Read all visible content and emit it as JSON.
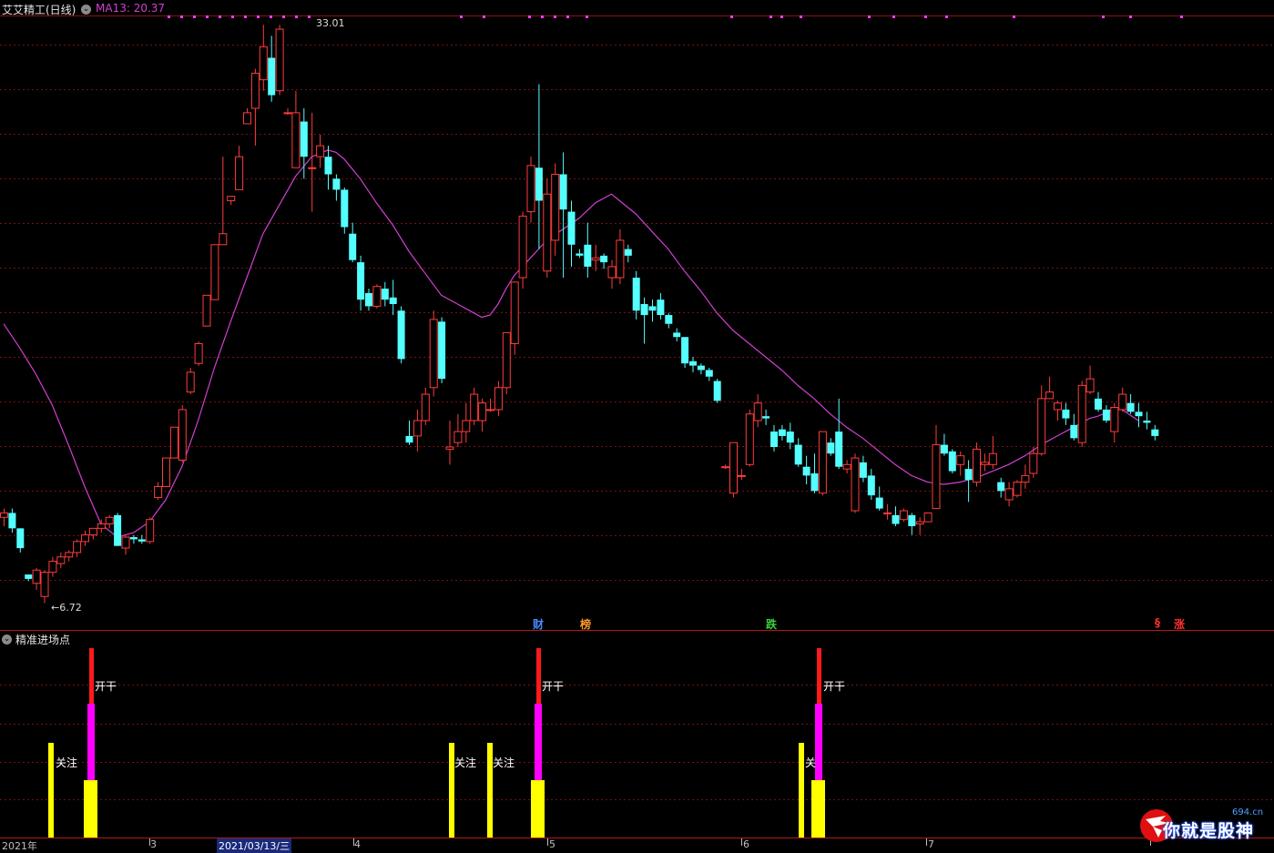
{
  "header": {
    "stock_name": "艾艾精工(日线)",
    "ma_label": "MA13: 20.37",
    "colors": {
      "title": "#e6e6e6",
      "ma": "#d040d0"
    }
  },
  "main_chart": {
    "high_label": "33.01",
    "low_label": "6.72",
    "event_labels": [
      {
        "text": "财",
        "color": "#4a8cff"
      },
      {
        "text": "榜",
        "color": "#ff9a2a"
      },
      {
        "text": "跌",
        "color": "#3bd13b"
      },
      {
        "text": "§",
        "color": "#ff3030"
      },
      {
        "text": "涨",
        "color": "#ff3030"
      }
    ],
    "colors": {
      "up": "#ff3c3c",
      "down": "#54ffff",
      "grid": "#7a1010",
      "ma": "#d040d0"
    }
  },
  "indicator": {
    "title": "精准进场点",
    "labels": {
      "watch": "关注",
      "open": "开干",
      "watch_partial": "关"
    },
    "colors": {
      "yellow": "#ffff00",
      "magenta": "#ff00ff",
      "red": "#ff1a1a"
    }
  },
  "axis": {
    "labels": [
      "2021年",
      "3",
      "2021/03/13/三",
      "4",
      "5",
      "6",
      "7"
    ]
  },
  "watermark": {
    "domain": "694.cn",
    "slogan": "你就是股神"
  },
  "chart_data": {
    "type": "candlestick",
    "title": "艾艾精工(日线)",
    "indicator": "MA13",
    "ma_last": 20.37,
    "price_high": 33.01,
    "price_low": 6.72,
    "y_range": [
      6.0,
      34.0
    ],
    "grid": true,
    "candles": [
      [
        10.6,
        11.0,
        10.2,
        10.8
      ],
      [
        10.8,
        11.0,
        9.9,
        10.1
      ],
      [
        10.1,
        10.1,
        9.0,
        9.2
      ],
      [
        8.0,
        8.0,
        7.7,
        7.8
      ],
      [
        7.6,
        8.3,
        7.3,
        8.2
      ],
      [
        7.0,
        8.2,
        6.7,
        8.1
      ],
      [
        8.1,
        8.8,
        7.9,
        8.6
      ],
      [
        8.5,
        9.0,
        8.3,
        8.8
      ],
      [
        8.8,
        9.1,
        8.6,
        9.0
      ],
      [
        9.0,
        9.6,
        8.8,
        9.5
      ],
      [
        9.5,
        10.0,
        9.3,
        9.8
      ],
      [
        9.8,
        10.1,
        9.6,
        10.1
      ],
      [
        10.1,
        10.5,
        9.9,
        10.3
      ],
      [
        10.3,
        10.7,
        10.1,
        10.6
      ],
      [
        10.7,
        10.8,
        9.3,
        9.3
      ],
      [
        9.2,
        9.8,
        8.9,
        9.7
      ],
      [
        9.7,
        9.8,
        9.4,
        9.6
      ],
      [
        9.6,
        9.8,
        9.4,
        9.5
      ],
      [
        9.5,
        10.6,
        9.4,
        10.5
      ],
      [
        11.5,
        12.2,
        11.4,
        12.0
      ],
      [
        12.0,
        13.3,
        12.0,
        13.3
      ],
      [
        13.3,
        14.7,
        13.3,
        14.7
      ],
      [
        13.2,
        15.7,
        13.1,
        15.5
      ],
      [
        16.3,
        17.4,
        16.2,
        17.2
      ],
      [
        17.6,
        18.6,
        17.5,
        18.5
      ],
      [
        19.3,
        20.7,
        19.3,
        20.7
      ],
      [
        20.5,
        23.0,
        20.5,
        23.0
      ],
      [
        23.0,
        27.0,
        23.0,
        23.5
      ],
      [
        25.0,
        25.2,
        24.8,
        25.2
      ],
      [
        25.5,
        27.5,
        25.5,
        27.0
      ],
      [
        28.5,
        29.2,
        28.5,
        29.0
      ],
      [
        29.2,
        31.0,
        27.5,
        30.8
      ],
      [
        30.5,
        33.0,
        30.0,
        32.0
      ],
      [
        31.5,
        32.5,
        29.5,
        29.8
      ],
      [
        30.0,
        33.0,
        29.8,
        32.8
      ],
      [
        29.0,
        29.2,
        28.9,
        29.0
      ],
      [
        26.5,
        30.0,
        26.5,
        29.0
      ],
      [
        28.6,
        29.2,
        26.0,
        27.0
      ],
      [
        26.5,
        29.0,
        24.5,
        26.5
      ],
      [
        27.0,
        28.0,
        26.5,
        27.5
      ],
      [
        27.0,
        27.5,
        25.5,
        26.2
      ],
      [
        26.0,
        26.2,
        25.0,
        25.5
      ],
      [
        25.5,
        25.6,
        23.5,
        23.8
      ],
      [
        23.5,
        24.0,
        22.2,
        22.3
      ],
      [
        22.2,
        22.5,
        20.0,
        20.5
      ],
      [
        20.8,
        21.0,
        20.0,
        20.2
      ],
      [
        20.2,
        21.2,
        20.1,
        21.1
      ],
      [
        21.0,
        21.3,
        20.2,
        20.5
      ],
      [
        20.6,
        21.4,
        19.8,
        20.3
      ],
      [
        20.0,
        20.2,
        17.6,
        17.8
      ],
      [
        14.3,
        15.0,
        13.9,
        14.0
      ],
      [
        14.3,
        15.5,
        13.6,
        15.0
      ],
      [
        15.0,
        16.5,
        14.8,
        16.2
      ],
      [
        16.5,
        20.0,
        16.1,
        19.6
      ],
      [
        19.5,
        19.7,
        16.7,
        16.9
      ],
      [
        13.7,
        15.0,
        13.0,
        13.8
      ],
      [
        14.0,
        15.3,
        13.8,
        14.5
      ],
      [
        14.5,
        15.8,
        14.0,
        15.0
      ],
      [
        15.0,
        16.5,
        14.8,
        16.2
      ],
      [
        15.0,
        16.0,
        14.5,
        15.8
      ],
      [
        15.5,
        16.0,
        15.4,
        15.5
      ],
      [
        15.5,
        16.8,
        15.2,
        16.5
      ],
      [
        16.5,
        19.0,
        16.2,
        19.0
      ],
      [
        18.5,
        21.3,
        18.0,
        21.3
      ],
      [
        21.5,
        24.5,
        21.0,
        24.3
      ],
      [
        24.5,
        27.0,
        24.0,
        26.6
      ],
      [
        26.5,
        30.3,
        22.8,
        25.0
      ],
      [
        21.8,
        26.0,
        21.5,
        25.3
      ],
      [
        23.2,
        26.7,
        22.5,
        26.2
      ],
      [
        26.2,
        27.2,
        21.5,
        24.6
      ],
      [
        24.5,
        25.0,
        22.0,
        23.0
      ],
      [
        22.6,
        22.8,
        22.4,
        22.5
      ],
      [
        23.0,
        24.0,
        21.5,
        22.0
      ],
      [
        22.3,
        23.0,
        21.8,
        22.4
      ],
      [
        22.5,
        22.6,
        21.9,
        22.2
      ],
      [
        21.5,
        22.3,
        21.0,
        22.0
      ],
      [
        21.5,
        23.7,
        21.2,
        23.2
      ],
      [
        22.8,
        23.0,
        22.2,
        22.5
      ],
      [
        21.5,
        21.8,
        19.6,
        20.0
      ],
      [
        20.3,
        20.6,
        18.5,
        19.8
      ],
      [
        20.2,
        20.5,
        19.5,
        20.0
      ],
      [
        20.5,
        20.8,
        19.6,
        19.8
      ],
      [
        19.8,
        19.9,
        19.2,
        19.4
      ],
      [
        19.0,
        19.2,
        18.6,
        18.8
      ],
      [
        18.8,
        18.8,
        17.4,
        17.6
      ],
      [
        17.7,
        17.9,
        17.2,
        17.5
      ],
      [
        17.5,
        17.6,
        17.1,
        17.3
      ],
      [
        17.3,
        17.4,
        16.8,
        17.0
      ],
      [
        16.8,
        16.9,
        15.8,
        15.9
      ],
      [
        12.9,
        13.0,
        12.8,
        12.9
      ],
      [
        11.7,
        14.0,
        11.5,
        14.0
      ],
      [
        12.5,
        12.8,
        12.3,
        12.5
      ],
      [
        13.0,
        15.5,
        12.9,
        15.3
      ],
      [
        15.0,
        16.2,
        14.7,
        15.8
      ],
      [
        15.2,
        15.5,
        14.8,
        15.1
      ],
      [
        14.5,
        14.8,
        13.6,
        13.8
      ],
      [
        14.6,
        14.8,
        14.1,
        14.3
      ],
      [
        14.5,
        14.9,
        13.7,
        14.0
      ],
      [
        13.9,
        14.2,
        12.9,
        13.0
      ],
      [
        12.9,
        13.4,
        12.1,
        12.5
      ],
      [
        12.6,
        13.5,
        11.7,
        11.8
      ],
      [
        11.7,
        14.5,
        11.6,
        14.5
      ],
      [
        14.0,
        14.2,
        13.4,
        13.5
      ],
      [
        14.5,
        16.0,
        12.8,
        12.9
      ],
      [
        12.8,
        13.2,
        12.6,
        13.0
      ],
      [
        10.9,
        13.5,
        10.8,
        13.3
      ],
      [
        13.1,
        13.4,
        12.2,
        12.4
      ],
      [
        12.5,
        12.8,
        11.4,
        11.6
      ],
      [
        11.5,
        12.0,
        10.9,
        11.0
      ],
      [
        10.8,
        11.2,
        10.5,
        10.8
      ],
      [
        10.7,
        11.1,
        10.2,
        10.3
      ],
      [
        10.5,
        11.0,
        10.4,
        10.9
      ],
      [
        10.7,
        10.8,
        9.8,
        10.2
      ],
      [
        10.3,
        10.6,
        9.8,
        10.4
      ],
      [
        10.4,
        10.8,
        10.4,
        10.8
      ],
      [
        11.0,
        14.8,
        11.0,
        13.9
      ],
      [
        13.9,
        14.4,
        13.4,
        13.5
      ],
      [
        13.6,
        13.7,
        12.6,
        12.7
      ],
      [
        13.0,
        13.6,
        12.5,
        13.4
      ],
      [
        12.8,
        13.2,
        11.3,
        12.3
      ],
      [
        12.2,
        14.0,
        12.0,
        13.7
      ],
      [
        13.0,
        13.5,
        12.7,
        13.1
      ],
      [
        13.0,
        14.3,
        12.8,
        13.5
      ],
      [
        12.2,
        12.4,
        11.5,
        11.8
      ],
      [
        11.4,
        12.2,
        11.1,
        11.9
      ],
      [
        11.6,
        12.3,
        11.5,
        12.2
      ],
      [
        12.2,
        13.0,
        11.9,
        12.5
      ],
      [
        12.6,
        13.8,
        12.4,
        13.5
      ],
      [
        13.5,
        16.6,
        13.4,
        16.0
      ],
      [
        16.0,
        17.0,
        16.0,
        16.3
      ],
      [
        15.5,
        15.9,
        15.0,
        15.8
      ],
      [
        15.5,
        15.8,
        14.8,
        15.1
      ],
      [
        14.8,
        15.3,
        14.1,
        14.2
      ],
      [
        14.0,
        16.8,
        13.8,
        16.6
      ],
      [
        16.3,
        17.5,
        16.2,
        16.9
      ],
      [
        16.0,
        16.3,
        15.4,
        15.5
      ],
      [
        15.5,
        15.7,
        14.9,
        15.0
      ],
      [
        14.5,
        15.8,
        14.0,
        15.6
      ],
      [
        15.5,
        16.5,
        15.4,
        16.2
      ],
      [
        15.8,
        16.2,
        15.3,
        15.4
      ],
      [
        15.4,
        15.8,
        14.7,
        15.2
      ],
      [
        15.0,
        15.4,
        14.6,
        14.9
      ],
      [
        14.6,
        14.8,
        14.1,
        14.3
      ]
    ],
    "ma13": [
      [
        0,
        19.4
      ],
      [
        2,
        18.3
      ],
      [
        4,
        17.1
      ],
      [
        6,
        15.7
      ],
      [
        8,
        13.9
      ],
      [
        10,
        12.0
      ],
      [
        12,
        10.3
      ],
      [
        14,
        9.7
      ],
      [
        16,
        9.9
      ],
      [
        18,
        10.4
      ],
      [
        20,
        11.4
      ],
      [
        22,
        12.9
      ],
      [
        24,
        15.0
      ],
      [
        26,
        17.4
      ],
      [
        28,
        19.5
      ],
      [
        30,
        21.5
      ],
      [
        32,
        23.5
      ],
      [
        34,
        24.8
      ],
      [
        36,
        26.1
      ],
      [
        38,
        27.0
      ],
      [
        40,
        27.3
      ],
      [
        41,
        27.2
      ],
      [
        42,
        26.9
      ],
      [
        44,
        26.0
      ],
      [
        46,
        24.9
      ],
      [
        48,
        23.9
      ],
      [
        50,
        22.7
      ],
      [
        52,
        21.7
      ],
      [
        54,
        20.7
      ],
      [
        56,
        20.3
      ],
      [
        58,
        19.9
      ],
      [
        59,
        19.7
      ],
      [
        60,
        19.8
      ],
      [
        61,
        20.3
      ],
      [
        62,
        21.0
      ],
      [
        63,
        21.6
      ],
      [
        65,
        22.4
      ],
      [
        67,
        23.2
      ],
      [
        69,
        23.7
      ],
      [
        71,
        24.2
      ],
      [
        73,
        24.9
      ],
      [
        75,
        25.3
      ],
      [
        76,
        25.0
      ],
      [
        78,
        24.4
      ],
      [
        80,
        23.6
      ],
      [
        82,
        22.8
      ],
      [
        84,
        21.8
      ],
      [
        86,
        20.9
      ],
      [
        88,
        19.9
      ],
      [
        90,
        19.1
      ],
      [
        92,
        18.5
      ],
      [
        94,
        17.9
      ],
      [
        96,
        17.3
      ],
      [
        98,
        16.6
      ],
      [
        100,
        16.0
      ],
      [
        102,
        15.3
      ],
      [
        104,
        14.7
      ],
      [
        106,
        14.2
      ],
      [
        108,
        13.6
      ],
      [
        110,
        13.0
      ],
      [
        112,
        12.5
      ],
      [
        114,
        12.2
      ],
      [
        116,
        12.1
      ],
      [
        118,
        12.2
      ],
      [
        120,
        12.4
      ],
      [
        122,
        12.7
      ],
      [
        124,
        13.0
      ],
      [
        126,
        13.4
      ],
      [
        128,
        13.9
      ],
      [
        130,
        14.3
      ],
      [
        132,
        14.7
      ],
      [
        134,
        15.1
      ],
      [
        135,
        15.2
      ],
      [
        137,
        15.5
      ],
      [
        138,
        15.5
      ],
      [
        140,
        15.0
      ]
    ],
    "signals": [
      {
        "x": 55,
        "height": 0.5,
        "type": "watch",
        "label": "关注"
      },
      {
        "x": 100,
        "height": 1.0,
        "type": "open",
        "label": "开干"
      },
      {
        "x": 495,
        "height": 0.5,
        "type": "watch",
        "label": "关注"
      },
      {
        "x": 537,
        "height": 0.5,
        "type": "watch",
        "label": "关注"
      },
      {
        "x": 591,
        "height": 1.0,
        "type": "open",
        "label": "开干"
      },
      {
        "x": 879,
        "height": 0.5,
        "type": "watch",
        "label": "关"
      },
      {
        "x": 899,
        "height": 1.0,
        "type": "open",
        "label": "开干"
      }
    ]
  }
}
